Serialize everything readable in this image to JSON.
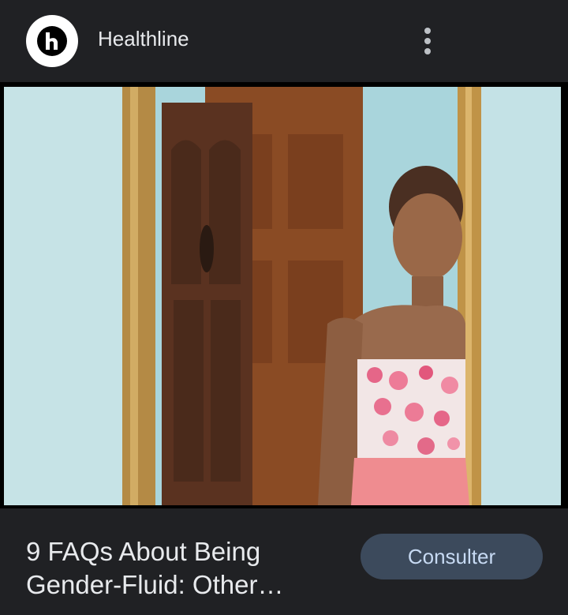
{
  "header": {
    "source_name": "Healthline",
    "logo_icon": "healthline-logo-icon",
    "more_icon": "more-vert-icon"
  },
  "article": {
    "image_alt": "Person in floral dress looking into mirror",
    "title": "9 FAQs About Being Gender-Fluid: Other…",
    "action_label": "Consulter"
  },
  "colors": {
    "background": "#202124",
    "button_bg": "#3c4a5c",
    "button_text": "#c7daf3"
  }
}
